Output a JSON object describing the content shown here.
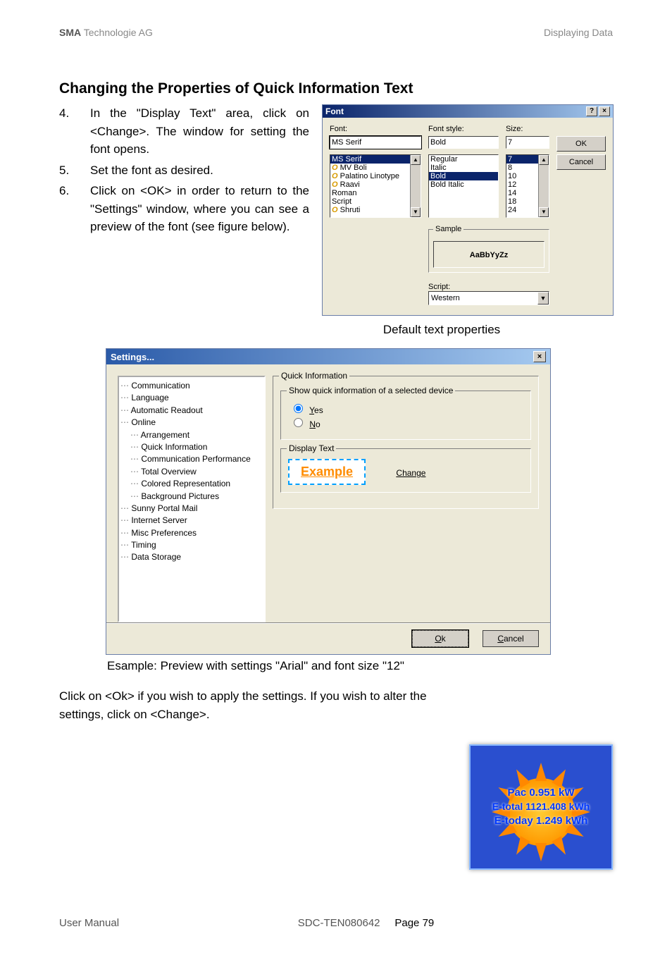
{
  "header": {
    "left_bold": "SMA",
    "left_rest": " Technologie AG",
    "right": "Displaying Data"
  },
  "title": "Changing the Properties of Quick Information Text",
  "steps": [
    {
      "n": "4.",
      "t": "In the \"Display Text\" area, click on <Change>. The window for setting the font opens."
    },
    {
      "n": "5.",
      "t": "Set the font as desired."
    },
    {
      "n": "6.",
      "t": "Click on <OK> in order to return to the \"Settings\" window, where you can see a preview of the font (see figure below)."
    }
  ],
  "font_dialog": {
    "title": "Font",
    "help": "?",
    "close": "×",
    "labels": {
      "font": "Font:",
      "style": "Font style:",
      "size": "Size:"
    },
    "values": {
      "font": "MS Serif",
      "style": "Bold",
      "size": "7"
    },
    "fonts": [
      "MS Serif",
      "MV Boli",
      "Palatino Linotype",
      "Raavi",
      "Roman",
      "Script",
      "Shruti"
    ],
    "styles": [
      "Regular",
      "Italic",
      "Bold",
      "Bold Italic"
    ],
    "sizes": [
      "7",
      "8",
      "10",
      "12",
      "14",
      "18",
      "24"
    ],
    "ok": "OK",
    "cancel": "Cancel",
    "sample_label": "Sample",
    "sample_text": "AaBbYyZz",
    "script_label": "Script:",
    "script_value": "Western"
  },
  "caption1": "Default text properties",
  "settings": {
    "title": "Settings...",
    "close": "×",
    "tree": [
      {
        "l": 0,
        "t": "Communication"
      },
      {
        "l": 0,
        "t": "Language"
      },
      {
        "l": 0,
        "t": "Automatic Readout"
      },
      {
        "l": 0,
        "t": "Online",
        "exp": true
      },
      {
        "l": 1,
        "t": "Arrangement"
      },
      {
        "l": 1,
        "t": "Quick Information"
      },
      {
        "l": 1,
        "t": "Communication Performance"
      },
      {
        "l": 1,
        "t": "Total Overview"
      },
      {
        "l": 1,
        "t": "Colored Representation"
      },
      {
        "l": 1,
        "t": "Background Pictures"
      },
      {
        "l": 0,
        "t": "Sunny Portal Mail"
      },
      {
        "l": 0,
        "t": "Internet Server"
      },
      {
        "l": 0,
        "t": "Misc Preferences"
      },
      {
        "l": 0,
        "t": "Timing"
      },
      {
        "l": 0,
        "t": "Data Storage"
      }
    ],
    "group1": "Quick Information",
    "group2": "Show quick information of a selected device",
    "yes": "Yes",
    "no": "No",
    "group3": "Display Text",
    "example": "Example",
    "change": "Change",
    "ok": "Ok",
    "cancel": "Cancel"
  },
  "caption2": "Esample: Preview with settings \"Arial\" and font size \"12\"",
  "para": "Click on <Ok> if you wish to apply the settings. If you wish to alter the settings, click on <Change>.",
  "sun": {
    "l1": "Pac 0.951 kW",
    "l2": "E-total 1121.408 kWh",
    "l3": "E-today 1.249 kWh"
  },
  "footer": {
    "left": "User Manual",
    "mid": "SDC-TEN080642",
    "page_label": "Page ",
    "page_num": "79"
  }
}
